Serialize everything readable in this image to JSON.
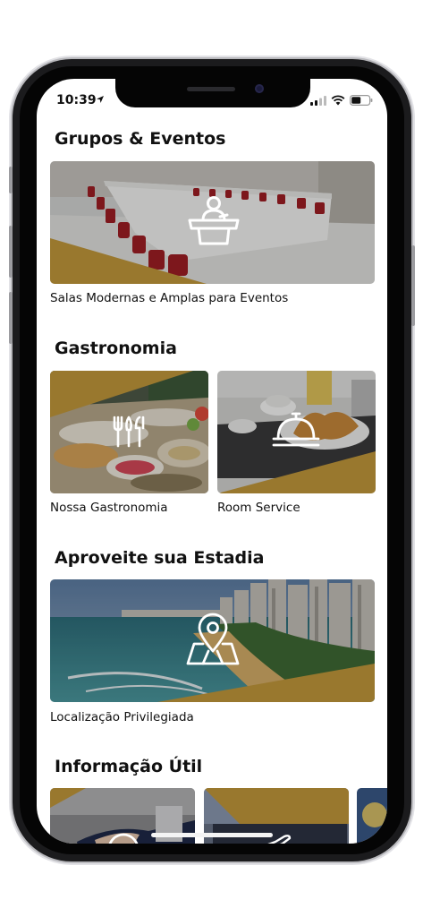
{
  "status_bar": {
    "time": "10:39"
  },
  "colors": {
    "accent_gold": "#C49A3C",
    "text": "#111111"
  },
  "sections": {
    "groups": {
      "title": "Grupos & Eventos",
      "cards": [
        {
          "caption": "Salas Modernas e Amplas para Eventos",
          "icon": "presenter-podium-icon"
        }
      ]
    },
    "gastronomy": {
      "title": "Gastronomia",
      "cards": [
        {
          "caption": "Nossa Gastronomia",
          "icon": "cutlery-icon"
        },
        {
          "caption": "Room Service",
          "icon": "service-bell-icon"
        }
      ]
    },
    "stay": {
      "title": "Aproveite sua Estadia",
      "cards": [
        {
          "caption": "Localização Privilegiada",
          "icon": "map-pin-icon"
        }
      ]
    },
    "info": {
      "title": "Informação Útil",
      "cards": [
        {
          "icon": "phone-icon"
        },
        {
          "icon": "airplane-icon"
        },
        {
          "icon": "info-icon"
        }
      ]
    }
  }
}
